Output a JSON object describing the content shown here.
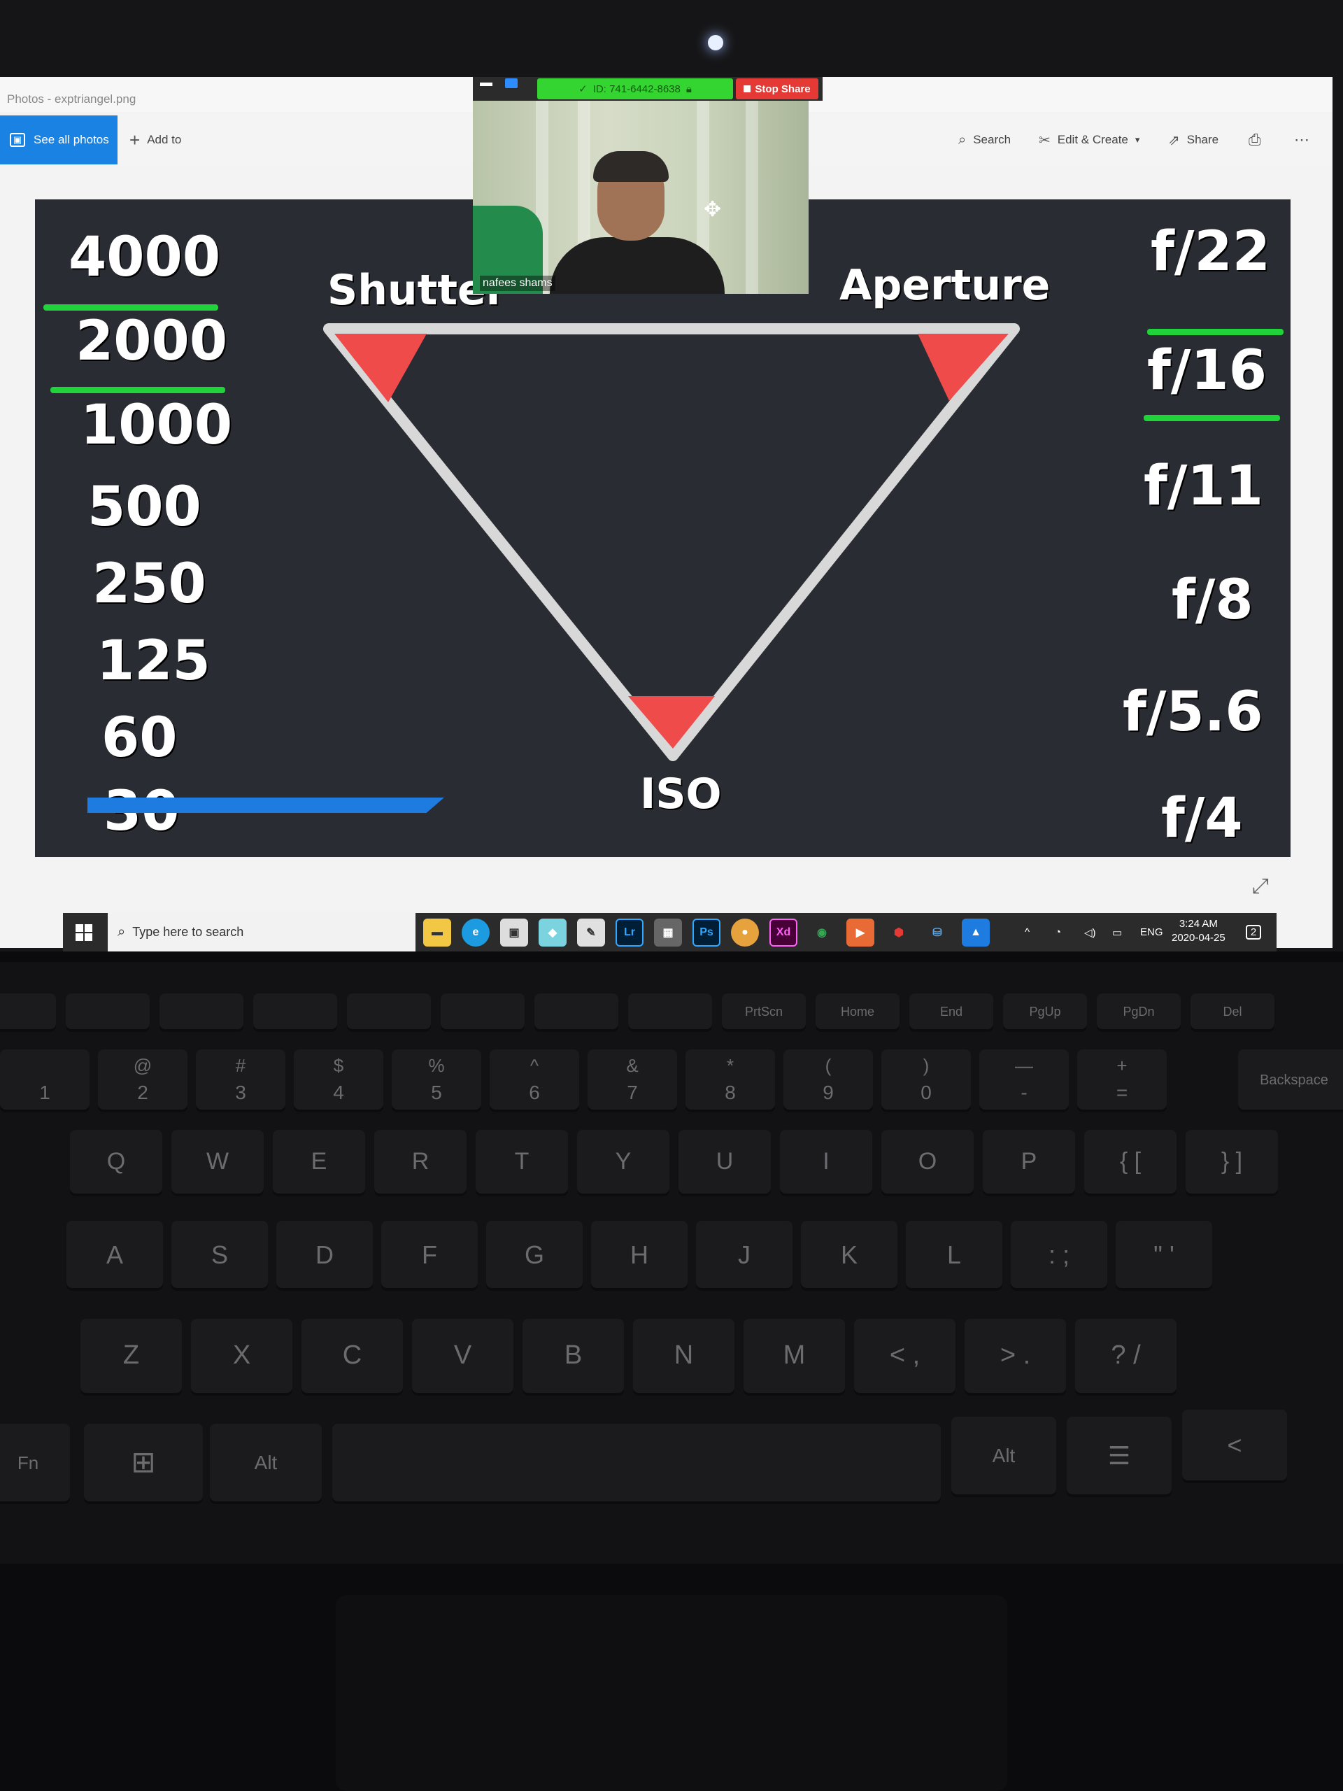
{
  "window": {
    "title": "Photos - exptriangel.png",
    "see_all_photos": "See all photos",
    "add_to": "Add to",
    "search": "Search",
    "edit_create": "Edit & Create",
    "share": "Share"
  },
  "zoom": {
    "meeting_id": "ID: 741-6442-8638",
    "stop_share": "Stop Share",
    "participant": "nafees shams"
  },
  "slide": {
    "shutter_label": "Shutter",
    "aperture_label": "Aperture",
    "iso_label": "ISO",
    "shutter_values": [
      "4000",
      "2000",
      "1000",
      "500",
      "250",
      "125",
      "60",
      "30"
    ],
    "aperture_values": [
      "f/22",
      "f/16",
      "f/11",
      "f/8",
      "f/5.6",
      "f/4"
    ],
    "accent_green": "#21d33b",
    "triangle_red": "#ef4b4b"
  },
  "taskbar": {
    "search_placeholder": "Type here to search",
    "lightroom": "Lr",
    "photoshop": "Ps",
    "xd": "Xd",
    "language": "ENG",
    "time": "3:24 AM",
    "date": "2020-04-25",
    "notifications": "2"
  },
  "keyboard": {
    "row_fn": [
      "PrtScn",
      "Home",
      "End",
      "PgUp",
      "PgDn",
      "Del"
    ],
    "row_num": [
      {
        "top": "",
        "bottom": "1"
      },
      {
        "top": "@",
        "bottom": "2"
      },
      {
        "top": "#",
        "bottom": "3"
      },
      {
        "top": "$",
        "bottom": "4"
      },
      {
        "top": "%",
        "bottom": "5"
      },
      {
        "top": "^",
        "bottom": "6"
      },
      {
        "top": "&",
        "bottom": "7"
      },
      {
        "top": "*",
        "bottom": "8"
      },
      {
        "top": "(",
        "bottom": "9"
      },
      {
        "top": ")",
        "bottom": "0"
      },
      {
        "top": "—",
        "bottom": "-"
      },
      {
        "top": "+",
        "bottom": "="
      }
    ],
    "backspace": "Backspace",
    "row_q": [
      "Q",
      "W",
      "E",
      "R",
      "T",
      "Y",
      "U",
      "I",
      "O",
      "P",
      "{ [",
      "} ]"
    ],
    "row_a": [
      "A",
      "S",
      "D",
      "F",
      "G",
      "H",
      "J",
      "K",
      "L",
      ": ;",
      "\" '"
    ],
    "row_z": [
      "Z",
      "X",
      "C",
      "V",
      "B",
      "N",
      "M",
      "< ,",
      "> .",
      "? /"
    ],
    "fn": "Fn",
    "alt_left": "Alt",
    "alt_right": "Alt"
  }
}
